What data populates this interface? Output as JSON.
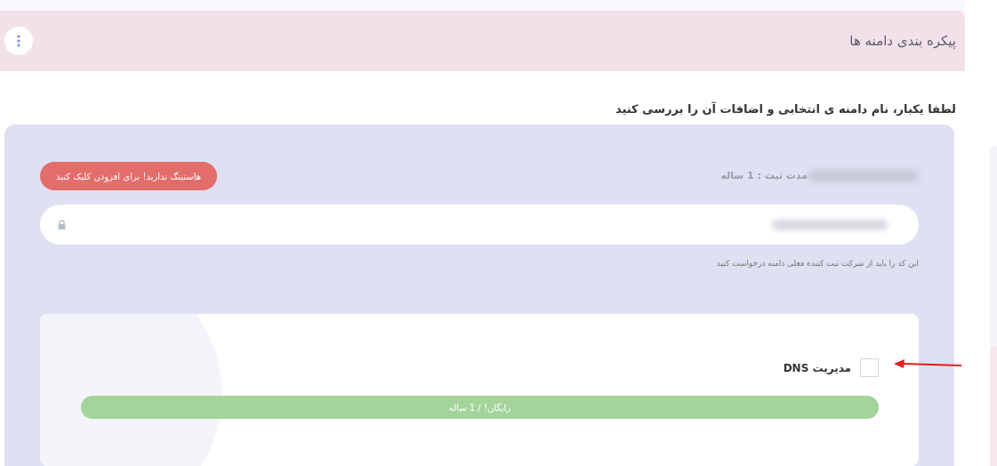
{
  "header": {
    "title": "پیکره بندی دامنه ها"
  },
  "instruction": "لطفا یکبار، نام دامنه ی انتخابی و اضافات آن را بررسی کنید",
  "domain": {
    "period": "مدت ثبت : 1 ساله",
    "hosting_button": "هاستینگ ندارید! برای افزودن کلیک کنید",
    "code_hint": "این کد را باید از شرکت ثبت کننده فعلی دامنه درخواست کنید"
  },
  "addons": [
    {
      "label": "مدیریت DNS",
      "checked": false,
      "price": "رایگان! / 1 ساله"
    }
  ]
}
